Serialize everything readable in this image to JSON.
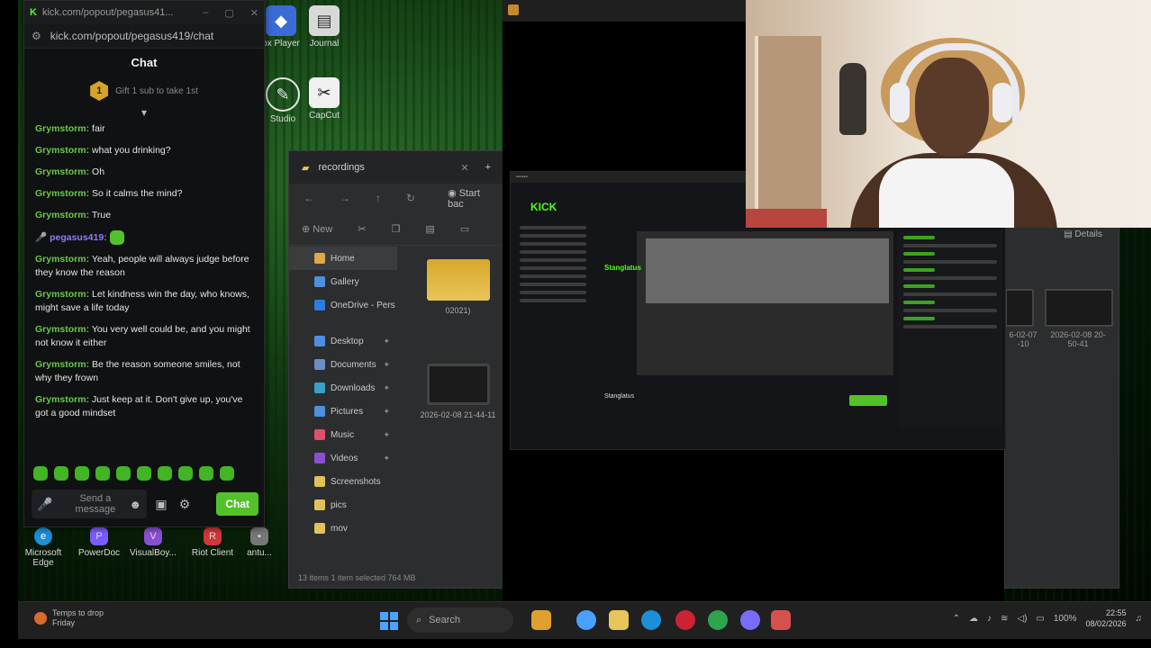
{
  "desktop": {
    "icons": [
      {
        "label": "ox Player",
        "icon": "roblox-icon",
        "color": "#3b6bd6"
      },
      {
        "label": "Journal",
        "icon": "journal-icon",
        "color": "#d8d8d8"
      },
      {
        "label": "Studio",
        "icon": "studio-icon",
        "color": "#e6e6e6"
      },
      {
        "label": "CapCut",
        "icon": "capcut-icon",
        "color": "#f0f0f0"
      },
      {
        "label": "Microsoft Edge",
        "icon": "edge-icon",
        "color": "#1b8fd8"
      },
      {
        "label": "PowerDoc",
        "icon": "powerdoc-icon",
        "color": "#7a5cff"
      },
      {
        "label": "VisualBoy...",
        "icon": "visualboy-icon",
        "color": "#8a4fd1"
      },
      {
        "label": "Riot Client",
        "icon": "riot-icon",
        "color": "#d13639"
      },
      {
        "label": "antu...",
        "icon": "app-icon",
        "color": "#777777"
      }
    ]
  },
  "chat": {
    "title_bar": "kick.com/popout/pegasus41...",
    "url": "kick.com/popout/pegasus419/chat",
    "header": "Chat",
    "gift_badge": "1",
    "gift_text": "Gift 1 sub to take 1st",
    "messages": [
      {
        "user": "Grymstorm:",
        "text": "fair"
      },
      {
        "user": "Grymstorm:",
        "text": "what you drinking?"
      },
      {
        "user": "Grymstorm:",
        "text": "Oh"
      },
      {
        "user": "Grymstorm:",
        "text": "So it calms the mind?"
      },
      {
        "user": "Grymstorm:",
        "text": "True"
      },
      {
        "user": "pegasus419:",
        "text": ""
      },
      {
        "user": "Grymstorm:",
        "text": "Yeah, people will always judge before they know the reason"
      },
      {
        "user": "Grymstorm:",
        "text": "Let kindness win the day, who knows, might save a life today"
      },
      {
        "user": "Grymstorm:",
        "text": "You very well could be, and you might not know it either"
      },
      {
        "user": "Grymstorm:",
        "text": "Be the reason someone smiles, not why they frown"
      },
      {
        "user": "Grymstorm:",
        "text": "Just keep at it. Don't give up, you've got a good mindset"
      }
    ],
    "input_placeholder": "Send a message",
    "send_label": "Chat",
    "accent": "#53c22a"
  },
  "explorer": {
    "tab_title": "recordings",
    "start_backup": "Start bac",
    "new_label": "New",
    "sidebar": [
      {
        "label": "Home",
        "color": "#e0a64a"
      },
      {
        "label": "Gallery",
        "color": "#4e8fe0"
      },
      {
        "label": "OneDrive - Pers",
        "color": "#2a7de1"
      },
      {
        "label": "Desktop",
        "color": "#4e8fe0"
      },
      {
        "label": "Documents",
        "color": "#6a8fc2"
      },
      {
        "label": "Downloads",
        "color": "#3aa0c9"
      },
      {
        "label": "Pictures",
        "color": "#4e8fe0"
      },
      {
        "label": "Music",
        "color": "#e04e6a"
      },
      {
        "label": "Videos",
        "color": "#8a4fd1"
      },
      {
        "label": "Screenshots",
        "color": "#e0c25a"
      },
      {
        "label": "pics",
        "color": "#e0c25a"
      },
      {
        "label": "mov",
        "color": "#e0c25a"
      }
    ],
    "files": [
      {
        "label": "02021)"
      },
      {
        "label": "2026-02-08 21-44-11"
      }
    ],
    "status": "13 items    1 item selected  764 MB"
  },
  "explorer2": {
    "details_label": "Details",
    "files": [
      {
        "label": "6-02-07 -10"
      },
      {
        "label": "2026-02-08 20-50-41"
      }
    ]
  },
  "capture": {
    "logo": "KICK",
    "streamer_logo": "Stanglatus",
    "streamer_name": "Stanglatus"
  },
  "taskbar": {
    "weather_line1": "Temps to drop",
    "weather_line2": "Friday",
    "search_placeholder": "Search",
    "apps": [
      {
        "icon": "crunchy-app-icon",
        "color": "#e0a030"
      },
      {
        "icon": "copilot-icon",
        "color": "#4aa0ff"
      },
      {
        "icon": "file-explorer-icon",
        "color": "#e8c55a"
      },
      {
        "icon": "edge-taskbar-icon",
        "color": "#1b8fd8"
      },
      {
        "icon": "dark-app-icon",
        "color": "#cc2233"
      },
      {
        "icon": "chrome-icon",
        "color": "#2da44e"
      },
      {
        "icon": "discord-icon",
        "color": "#7a6cff"
      },
      {
        "icon": "obs-icon",
        "color": "#d65050"
      }
    ],
    "battery": "100%",
    "time": "22:55",
    "date": "08/02/2026"
  }
}
